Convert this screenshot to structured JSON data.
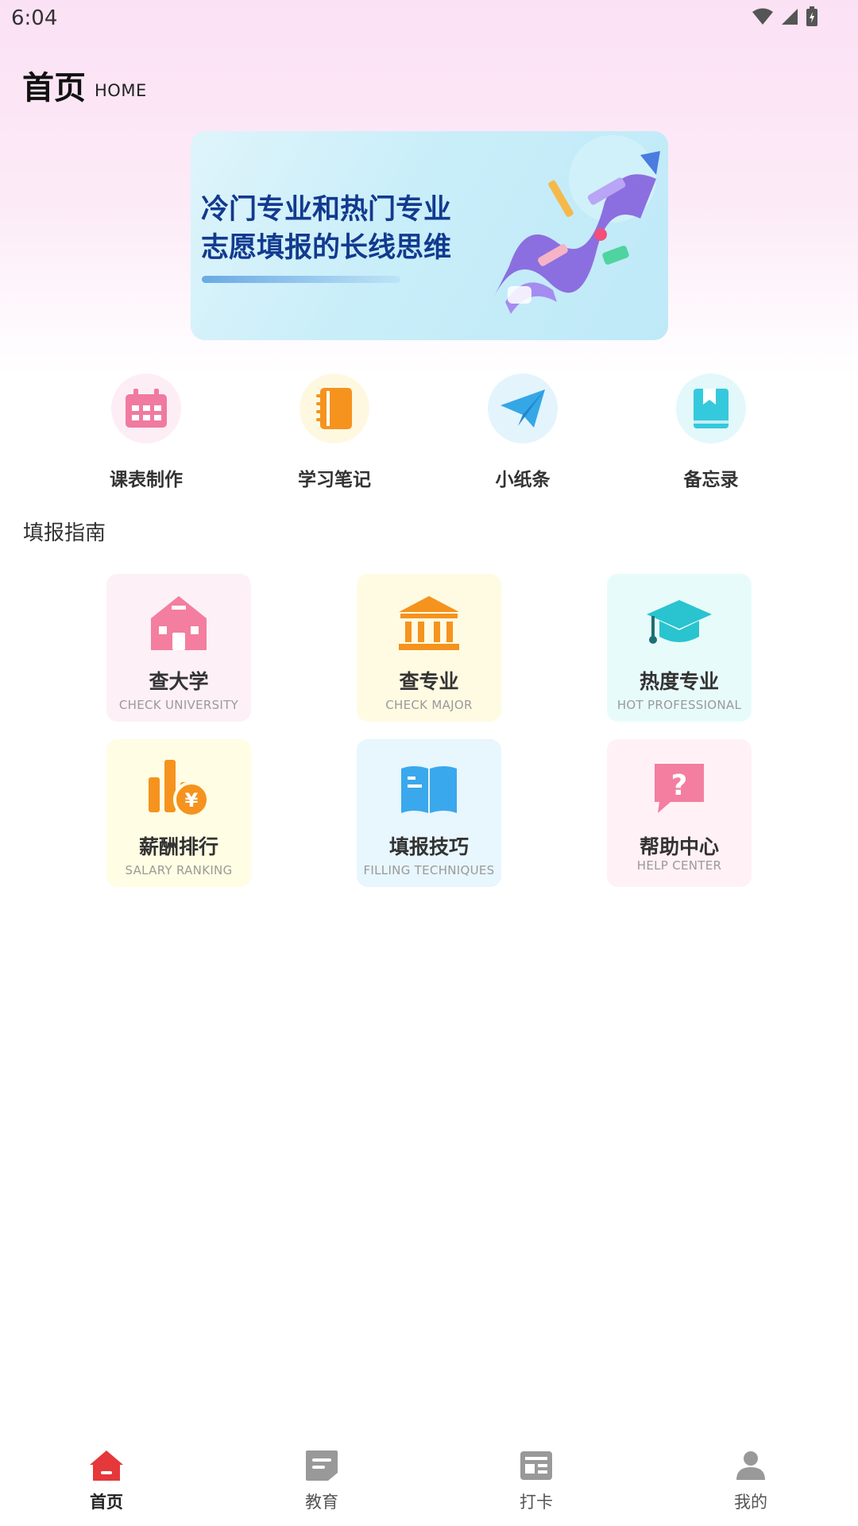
{
  "status": {
    "time": "6:04"
  },
  "header": {
    "title": "首页",
    "subtitle": "HOME"
  },
  "banner": {
    "line1": "冷门专业和热门专业",
    "line2": "志愿填报的长线思维"
  },
  "quick_actions": [
    {
      "label": "课表制作",
      "icon": "calendar-icon",
      "bg": "#fdeef5",
      "color": "#f07aa0"
    },
    {
      "label": "学习笔记",
      "icon": "notebook-icon",
      "bg": "#fff8e1",
      "color": "#f5931e"
    },
    {
      "label": "小纸条",
      "icon": "paper-plane-icon",
      "bg": "#e3f4fd",
      "color": "#35a7e6"
    },
    {
      "label": "备忘录",
      "icon": "bookmark-book-icon",
      "bg": "#e3f8fa",
      "color": "#35c9dd"
    }
  ],
  "guide": {
    "title": "填报指南",
    "cards": [
      {
        "title": "查大学",
        "sub": "CHECK UNIVERSITY",
        "icon": "university-building-icon",
        "bg": "#fdf0f6",
        "color": "#f37ea0"
      },
      {
        "title": "查专业",
        "sub": "CHECK MAJOR",
        "icon": "institution-columns-icon",
        "bg": "#fffbe3",
        "color": "#f5931e"
      },
      {
        "title": "热度专业",
        "sub": "HOT PROFESSIONAL",
        "icon": "graduation-cap-icon",
        "bg": "#e8fbfb",
        "color": "#29c4cf"
      },
      {
        "title": "薪酬排行",
        "sub": "SALARY RANKING",
        "icon": "salary-chart-icon",
        "bg": "#fffde3",
        "color": "#f5931e"
      },
      {
        "title": "填报技巧",
        "sub": "FILLING TECHNIQUES",
        "icon": "open-book-icon",
        "bg": "#e8f6fd",
        "color": "#3aa8ec"
      },
      {
        "title": "帮助中心",
        "sub": "HELP CENTER",
        "icon": "help-question-icon",
        "bg": "#fff1f6",
        "color": "#f37ea0"
      }
    ]
  },
  "nav": [
    {
      "label": "首页",
      "icon": "home-icon",
      "active": true
    },
    {
      "label": "教育",
      "icon": "education-doc-icon",
      "active": false
    },
    {
      "label": "打卡",
      "icon": "checkin-board-icon",
      "active": false
    },
    {
      "label": "我的",
      "icon": "profile-person-icon",
      "active": false
    }
  ],
  "colors": {
    "accent": "#e5383b",
    "nav_inactive": "#999999"
  }
}
